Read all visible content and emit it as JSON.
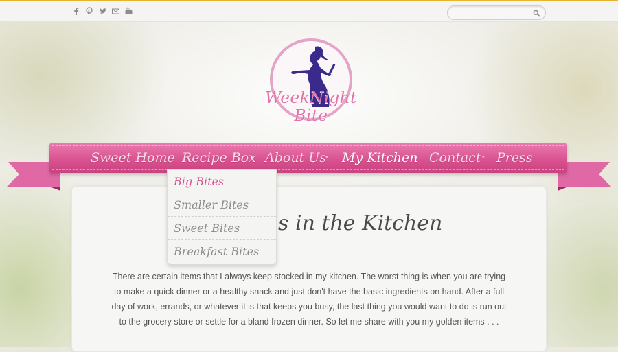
{
  "social": {
    "icons": [
      "facebook-icon",
      "pinterest-icon",
      "twitter-icon",
      "email-icon",
      "youtube-icon"
    ]
  },
  "search": {
    "placeholder": "",
    "value": ""
  },
  "logo": {
    "text": "WeekNight Bite"
  },
  "nav": {
    "items": [
      "Sweet Home",
      "Recipe Box",
      "About Us",
      "My Kitchen",
      "Contact",
      "Press"
    ],
    "active": "My Kitchen"
  },
  "dropdown": {
    "items": [
      "Big Bites",
      "Smaller Bites",
      "Sweet Bites",
      "Breakfast Bites"
    ]
  },
  "main": {
    "headline_visible": "ties in the Kitchen",
    "body": "There are certain items that I always keep stocked in my kitchen. The worst thing is when you are trying to make a quick dinner or a healthy snack and just don't have the basic ingredients on hand. After a full day of work, errands, or whatever it is that keeps you busy, the last thing you would want to do is run out to the grocery store or settle for a bland frozen dinner. So let me share with you my golden items . . ."
  },
  "colors": {
    "accent": "#d9508f",
    "topbar_line": "#e7b431",
    "logo_purple": "#3a2a8c"
  }
}
